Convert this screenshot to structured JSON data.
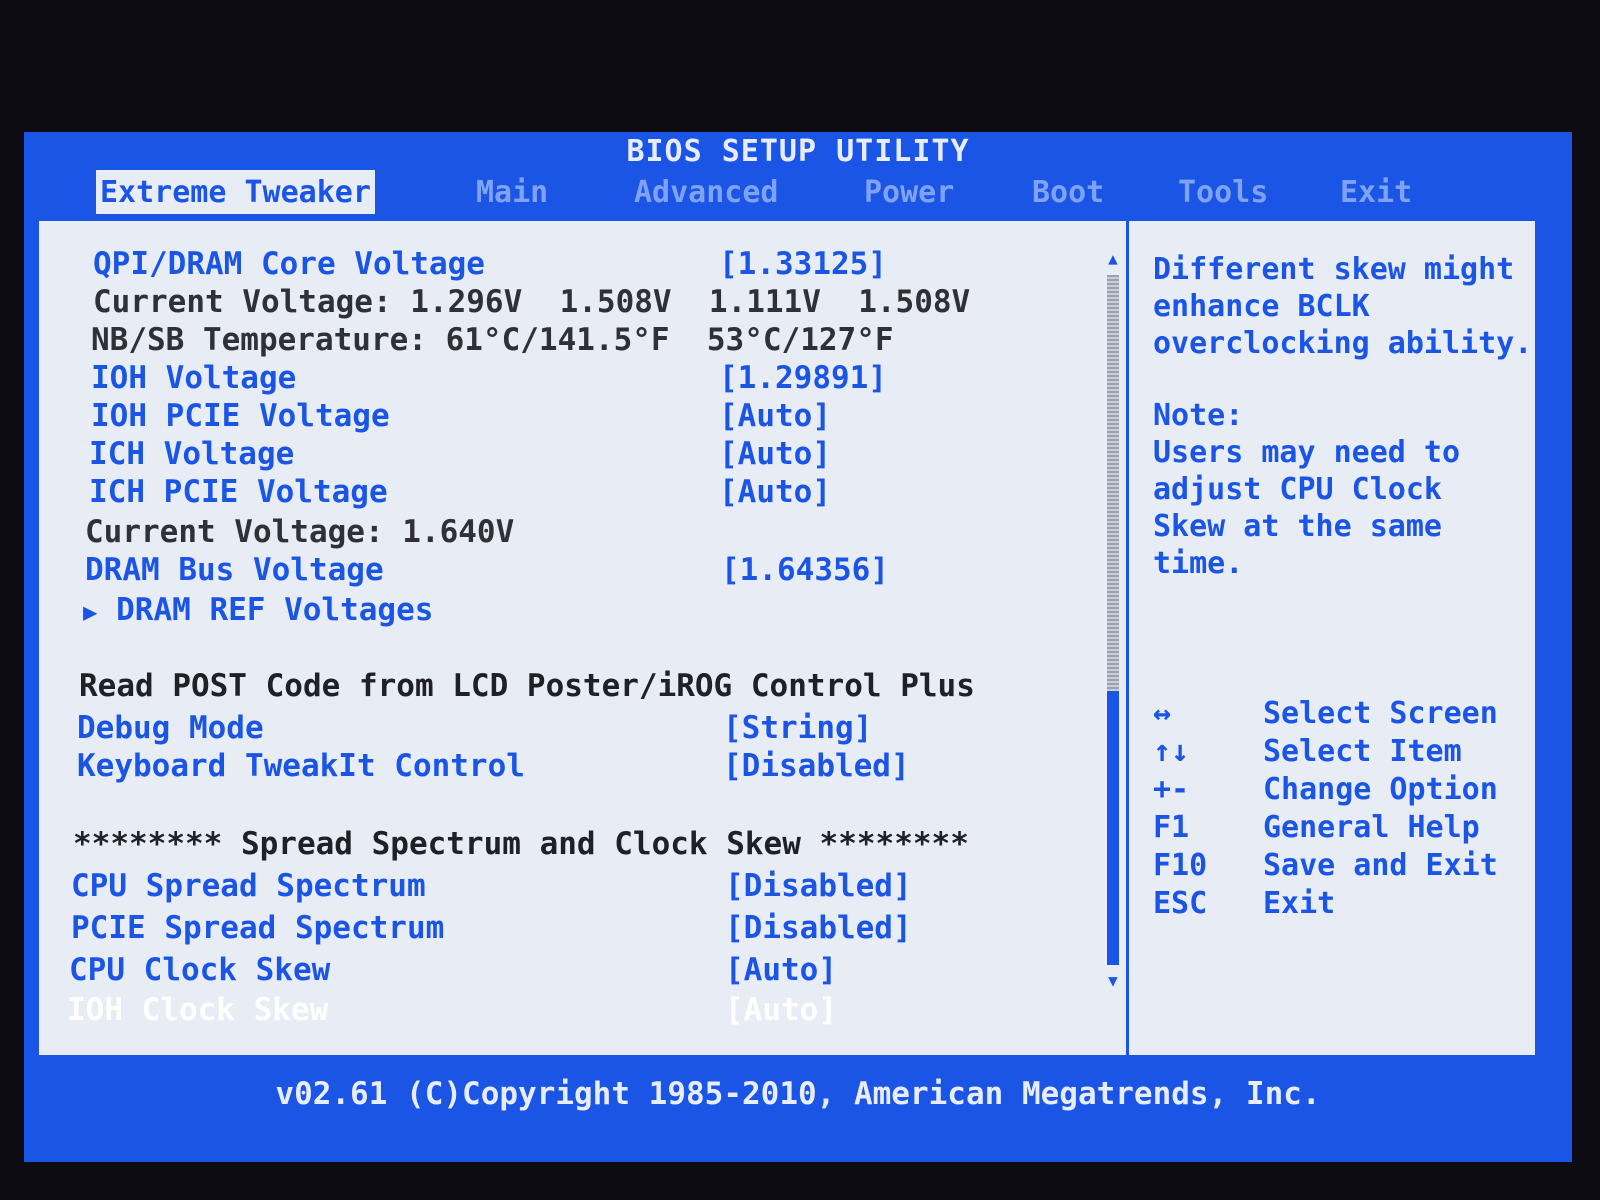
{
  "title": "BIOS SETUP UTILITY",
  "tabs": [
    {
      "label": "Extreme Tweaker",
      "active": true
    },
    {
      "label": "Main"
    },
    {
      "label": "Advanced"
    },
    {
      "label": "Power"
    },
    {
      "label": "Boot"
    },
    {
      "label": "Tools"
    },
    {
      "label": "Exit"
    }
  ],
  "settings": {
    "qpi_dram_core_voltage": {
      "label": "QPI/DRAM Core Voltage",
      "value": "[1.33125]"
    },
    "current_voltage_1": "Current Voltage: 1.296V  1.508V  1.111V  1.508V",
    "nb_sb_temperature": "NB/SB Temperature: 61°C/141.5°F  53°C/127°F",
    "ioh_voltage": {
      "label": "IOH Voltage",
      "value": "[1.29891]"
    },
    "ioh_pcie_voltage": {
      "label": "IOH PCIE Voltage",
      "value": "[Auto]"
    },
    "ich_voltage": {
      "label": "ICH Voltage",
      "value": "[Auto]"
    },
    "ich_pcie_voltage": {
      "label": "ICH PCIE Voltage",
      "value": "[Auto]"
    },
    "current_voltage_2": "Current Voltage: 1.640V",
    "dram_bus_voltage": {
      "label": "DRAM Bus Voltage",
      "value": "[1.64356]"
    },
    "dram_ref_voltages": {
      "label": "DRAM REF Voltages",
      "marker": "▶"
    },
    "read_post_code_heading": "Read POST Code from LCD Poster/iROG Control Plus",
    "debug_mode": {
      "label": "Debug Mode",
      "value": "[String]"
    },
    "keyboard_tweakit_control": {
      "label": "Keyboard TweakIt Control",
      "value": "[Disabled]"
    },
    "spread_spectrum_heading": "******** Spread Spectrum and Clock Skew ********",
    "cpu_spread_spectrum": {
      "label": "CPU Spread Spectrum",
      "value": "[Disabled]"
    },
    "pcie_spread_spectrum": {
      "label": "PCIE Spread Spectrum",
      "value": "[Disabled]"
    },
    "cpu_clock_skew": {
      "label": "CPU Clock Skew",
      "value": "[Auto]"
    },
    "ioh_clock_skew": {
      "label": "IOH Clock Skew",
      "value": "[Auto]",
      "selected": true
    }
  },
  "help": {
    "lines": [
      "Different skew might",
      "enhance BCLK",
      "overclocking ability."
    ],
    "note_title": "Note:",
    "note_lines": [
      "Users may need to",
      "adjust CPU Clock",
      "Skew at the same",
      "time."
    ]
  },
  "keys": [
    {
      "key": "↔",
      "action": "Select Screen"
    },
    {
      "key": "↑↓",
      "action": "Select Item"
    },
    {
      "key": "+-",
      "action": "Change Option"
    },
    {
      "key": "F1",
      "action": "General Help"
    },
    {
      "key": "F10",
      "action": "Save and Exit"
    },
    {
      "key": "ESC",
      "action": "Exit"
    }
  ],
  "footer": "v02.61 (C)Copyright 1985-2010, American Megatrends, Inc.",
  "colors": {
    "accent": "#1a55e6",
    "panel": "#e8ecf4",
    "selected_text": "#ffffff"
  }
}
